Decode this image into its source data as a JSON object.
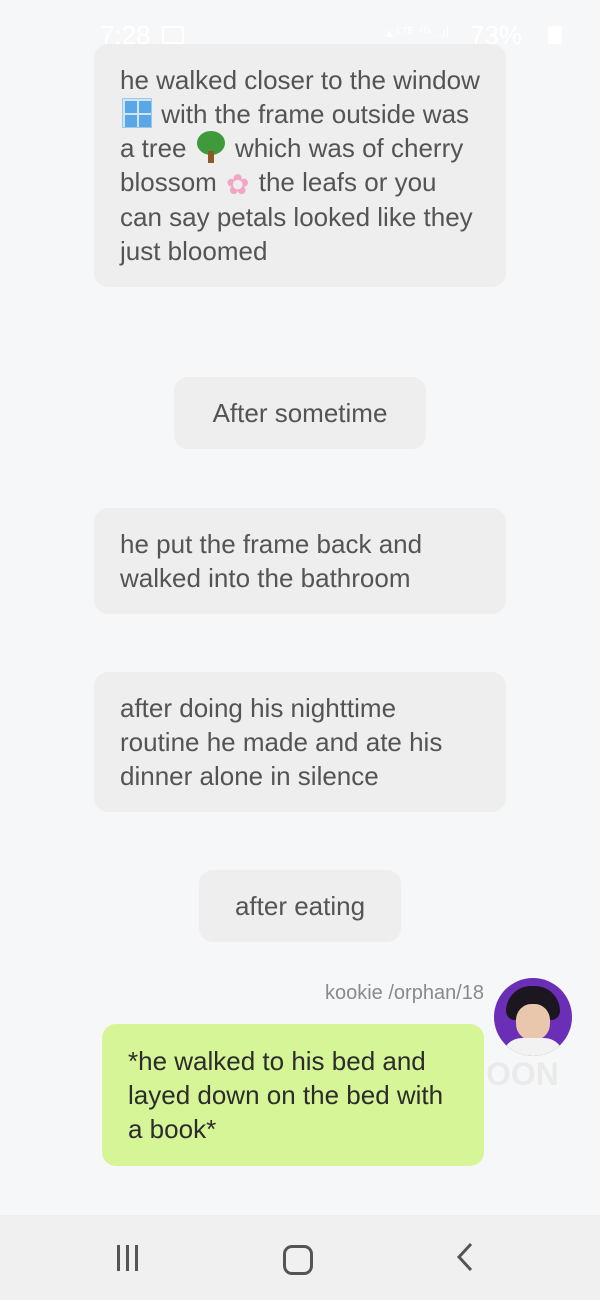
{
  "status_bar": {
    "time": "7:28",
    "battery": "73%",
    "icons": [
      "gallery-icon",
      "lock-icon",
      "signal-icon",
      "battery-icon"
    ]
  },
  "messages": [
    {
      "id": "narration_1",
      "parts": [
        "he walked closer to the window ",
        " with the frame outside was a tree ",
        " which was of cherry blossom ",
        " the leafs or you can say petals looked like they just bloomed"
      ],
      "emojis": [
        "window-emoji",
        "deciduous-tree-emoji",
        "cherry-blossom-emoji"
      ]
    },
    {
      "id": "pill_1",
      "text": "After sometime"
    },
    {
      "id": "narration_2",
      "text": "he put the frame back and walked into the bathroom"
    },
    {
      "id": "narration_3",
      "text": "after doing his nighttime routine he made and ate his dinner alone in silence"
    },
    {
      "id": "pill_2",
      "text": "after eating"
    }
  ],
  "user_message": {
    "sender": "kookie /orphan/18",
    "text": "*he walked to his bed and layed down on the bed with a book*",
    "watermark": "OON"
  },
  "colors": {
    "background": "#f6f7f9",
    "narration_bubble": "#eeeeee",
    "user_bubble": "#d6f596",
    "nav_bar": "#f0f0f0"
  },
  "nav": [
    "recent-apps-icon",
    "home-icon",
    "back-icon"
  ]
}
